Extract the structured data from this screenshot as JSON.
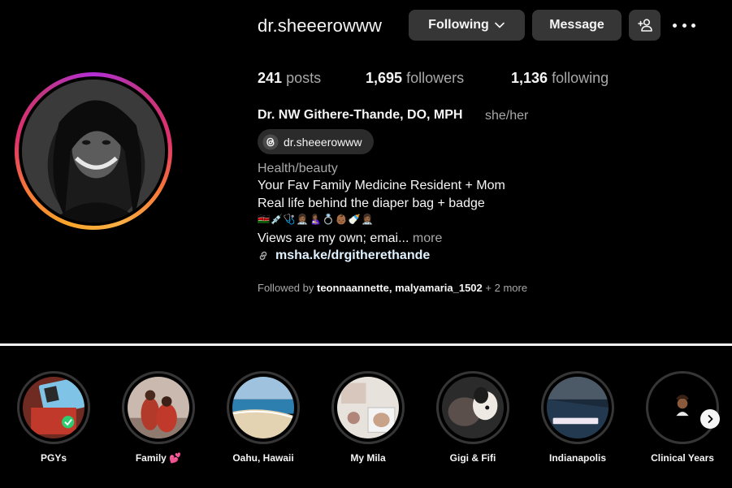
{
  "profile": {
    "username": "dr.sheeerowww",
    "full_name": "Dr. NW Githere-Thande, DO, MPH",
    "pronouns": "she/her",
    "threads_handle": "dr.sheeerowww",
    "category": "Health/beauty",
    "bio_lines": [
      "Your Fav Family Medicine Resident + Mom",
      "Real life behind the diaper bag + badge",
      "🇰🇪💉🩺👩🏾‍⚕️🤱🏾💍👶🏾🍼👩🏾‍⚕️"
    ],
    "bio_truncated": "Views are my own; emai...",
    "more_label": "more",
    "link": "msha.ke/drgitherethande"
  },
  "actions": {
    "following_label": "Following",
    "message_label": "Message"
  },
  "stats": {
    "posts_count": "241",
    "posts_label": "posts",
    "followers_count": "1,695",
    "followers_label": "followers",
    "following_count": "1,136",
    "following_label": "following"
  },
  "followed_by": {
    "prefix": "Followed by",
    "names": "teonnaannette, malyamaria_1502",
    "suffix": "+ 2 more"
  },
  "highlights": [
    {
      "label": "PGYs"
    },
    {
      "label": "Family 💕"
    },
    {
      "label": "Oahu, Hawaii"
    },
    {
      "label": "My Mila"
    },
    {
      "label": "Gigi & Fifi"
    },
    {
      "label": "Indianapolis"
    },
    {
      "label": "Clinical Years"
    }
  ],
  "icons": {
    "dropdown": "chevron-down-icon",
    "add_user": "add-user-icon",
    "more": "more-horizontal-icon",
    "threads": "threads-icon",
    "link": "link-icon",
    "next": "chevron-right-icon"
  },
  "colors": {
    "background": "#000000",
    "button": "#363636",
    "secondary_text": "#a8a8a8",
    "link_text": "#e0f1ff"
  }
}
